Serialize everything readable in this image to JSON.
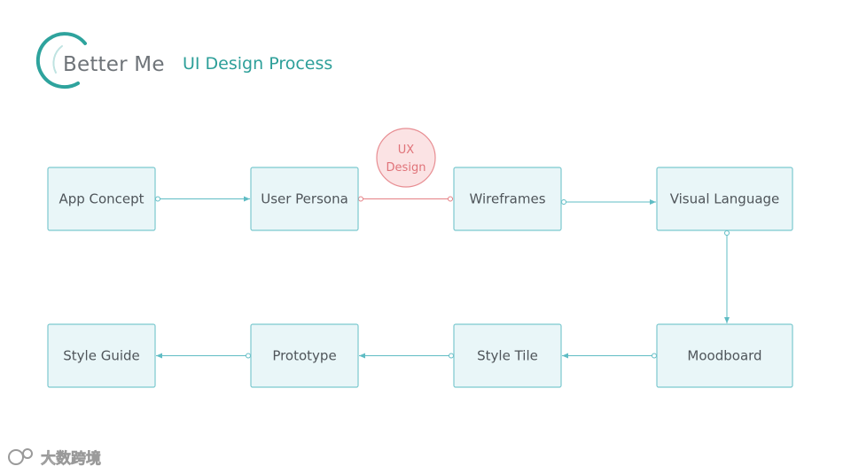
{
  "header": {
    "logo_text": "Better Me",
    "subtitle": "UI Design Process"
  },
  "badge": {
    "line1": "UX",
    "line2": "Design"
  },
  "nodes": [
    {
      "id": "app-concept",
      "label": "App Concept"
    },
    {
      "id": "user-persona",
      "label": "User Persona"
    },
    {
      "id": "wireframes",
      "label": "Wireframes"
    },
    {
      "id": "visual-language",
      "label": "Visual Language"
    },
    {
      "id": "moodboard",
      "label": "Moodboard"
    },
    {
      "id": "style-tile",
      "label": "Style Tile"
    },
    {
      "id": "prototype",
      "label": "Prototype"
    },
    {
      "id": "style-guide",
      "label": "Style Guide"
    }
  ],
  "edges": [
    {
      "from": "app-concept",
      "to": "user-persona"
    },
    {
      "from": "user-persona",
      "to": "wireframes",
      "highlight": true
    },
    {
      "from": "wireframes",
      "to": "visual-language"
    },
    {
      "from": "visual-language",
      "to": "moodboard"
    },
    {
      "from": "moodboard",
      "to": "style-tile"
    },
    {
      "from": "style-tile",
      "to": "prototype"
    },
    {
      "from": "prototype",
      "to": "style-guide"
    }
  ],
  "watermark": {
    "text": "大数跨境"
  },
  "colors": {
    "accent": "#2d9f99",
    "box_fill": "#e9f6f8",
    "box_stroke": "#7cc9cf",
    "connector": "#5fbcc4",
    "highlight": "#e57f84"
  }
}
